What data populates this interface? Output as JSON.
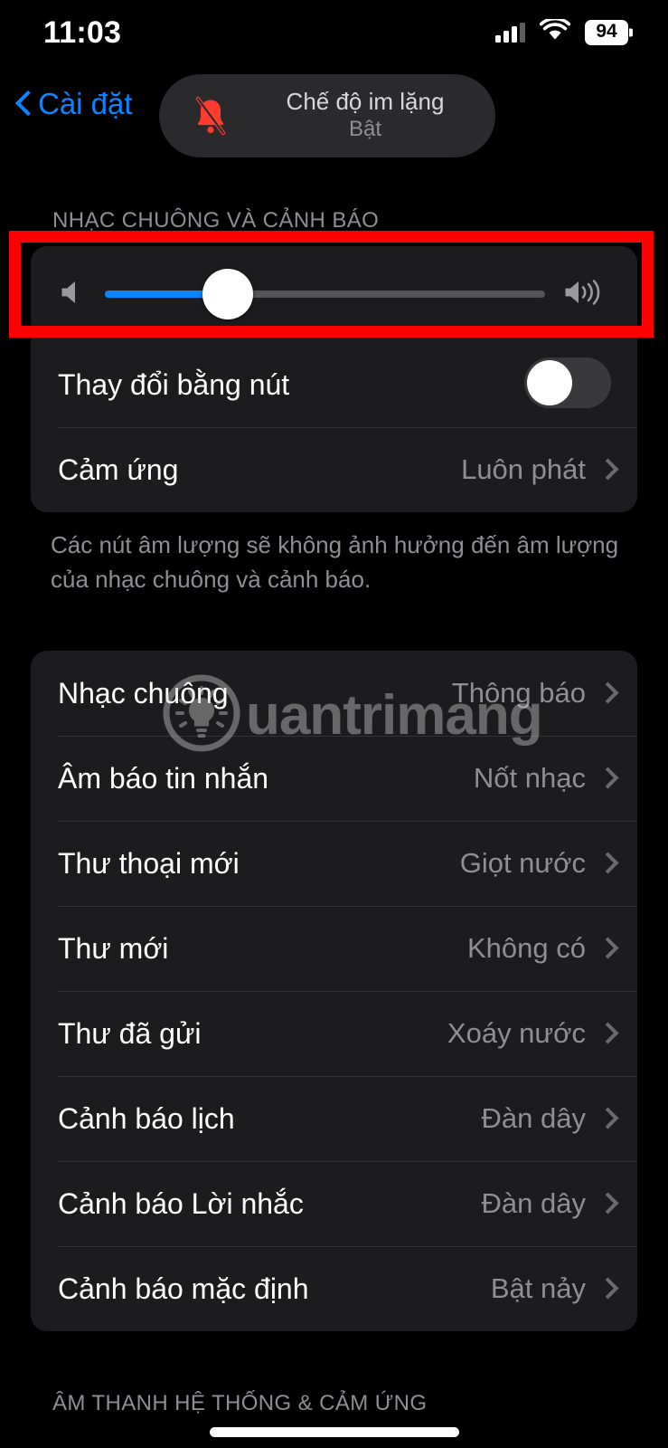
{
  "status_bar": {
    "time": "11:03",
    "battery_percent": "94",
    "cellular_icon": "cellular-bars-icon",
    "wifi_icon": "wifi-icon",
    "battery_icon": "battery-icon"
  },
  "nav": {
    "back_label": "Cài đặt",
    "back_icon": "chevron-left-icon",
    "silent_mode": {
      "icon": "bell-slash-icon",
      "title": "Chế độ im lặng",
      "subtitle": "Bật"
    }
  },
  "sections": {
    "ringer": {
      "header": "NHẠC CHUÔNG VÀ CẢNH BÁO",
      "slider": {
        "name": "ringer-volume-slider",
        "value_percent": 28,
        "left_icon": "speaker-low-icon",
        "right_icon": "speaker-high-icon",
        "fill_color": "#0a84ff",
        "track_color": "#545456"
      },
      "rows": [
        {
          "label": "Thay đổi bằng nút",
          "type": "toggle",
          "value": "off"
        },
        {
          "label": "Cảm ứng",
          "type": "link",
          "value": "Luôn phát"
        }
      ],
      "footer": "Các nút âm lượng sẽ không ảnh hưởng đến âm lượng của nhạc chuông và cảnh báo."
    },
    "sounds": {
      "rows": [
        {
          "label": "Nhạc chuông",
          "value": "Thông báo"
        },
        {
          "label": "Âm báo tin nhắn",
          "value": "Nốt nhạc"
        },
        {
          "label": "Thư thoại mới",
          "value": "Giọt nước"
        },
        {
          "label": "Thư mới",
          "value": "Không có"
        },
        {
          "label": "Thư đã gửi",
          "value": "Xoáy nước"
        },
        {
          "label": "Cảnh báo lịch",
          "value": "Đàn dây"
        },
        {
          "label": "Cảnh báo Lời nhắc",
          "value": "Đàn dây"
        },
        {
          "label": "Cảnh báo mặc định",
          "value": "Bật nảy"
        }
      ]
    },
    "system": {
      "header": "ÂM THANH HỆ THỐNG & CẢM ỨNG"
    }
  },
  "annotation": {
    "name": "red-highlight-box",
    "color": "#fe0000"
  },
  "watermark": {
    "text": "uantrimang",
    "logo_icon": "lightbulb-circle-logo"
  },
  "colors": {
    "accent_blue": "#0a84ff",
    "card_bg": "#1c1c1e",
    "page_bg": "#000000",
    "secondary_text": "#8e8e93",
    "silent_red": "#ff3b30"
  }
}
